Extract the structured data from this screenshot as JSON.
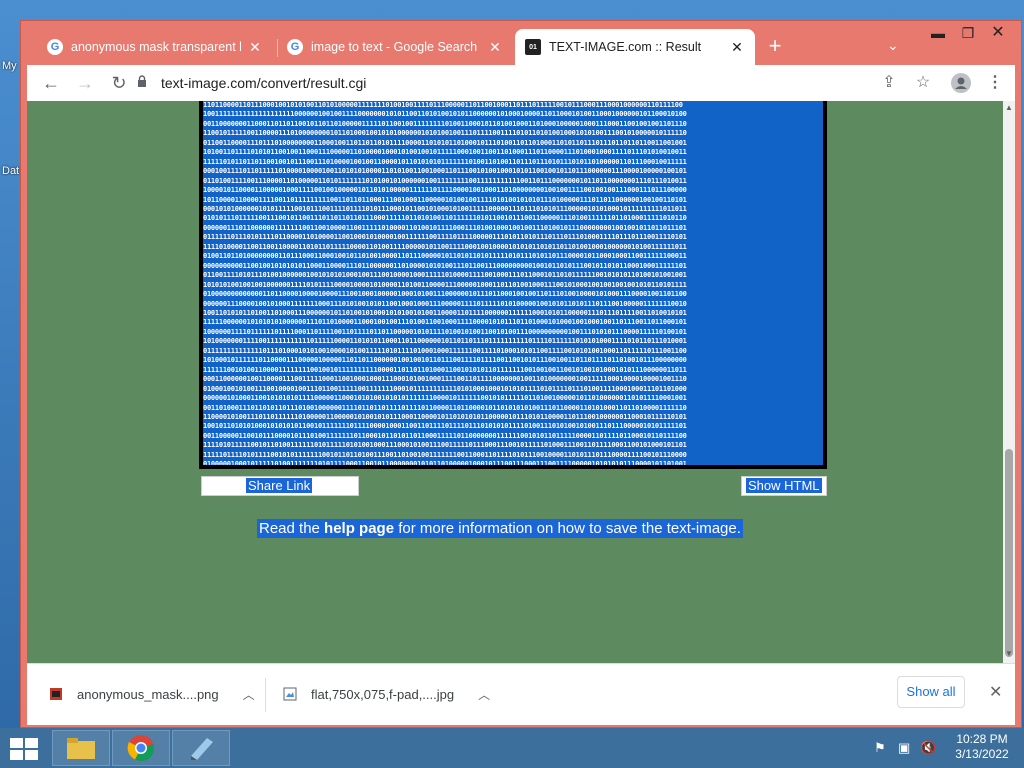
{
  "desktop": {
    "labels": [
      "My",
      "Dat"
    ]
  },
  "browser": {
    "tabs": [
      {
        "title": "anonymous mask transparent ba",
        "icon": "google-icon"
      },
      {
        "title": "image to text - Google Search",
        "icon": "google-icon"
      },
      {
        "title": "TEXT-IMAGE.com :: Result",
        "icon": "text-image-icon",
        "active": true
      }
    ],
    "url": "text-image.com/convert/result.cgi"
  },
  "page": {
    "binary_rows": [
      "1101100001101110001001010100110101000001111111010010011110111000001101100100011011101111100101110001110001000000110111100",
      "10011111111111111111111000000100100111100000001010110011010100101011000000101000100001101100010100110001000000101100010100",
      "00110000000110001101101100101101101000001111101100100111111110100110001811010010001101000100000100011100011001001001101110",
      "11001011111001100001110100000000101101000100101010000001010100100111011110011110101101010010001010100111001010000010111110",
      "01100110000111011101000000001100010011011011010111100001101010110100010111010011011010001101011011101110110110110011001001",
      "10100110111101010110010011000111000001101000010001010010010111110001001100110100011101100001110100010001111011101010010011",
      "11111010110110110010010111001110100001001001100001011010101011111110100110100110111011101011101011010000011011100010011111",
      "00010011110110111110100001000010011010101000011010100110010001101110010100100010101100100101101110000001110000100000100101",
      "01101001111001110000110100000110101111111010100101000000100111111110011111111111001101110000000101101100000001110111010011",
      "10000101100001100000100011110010010000010110101000001111110111100001001000110100000000100100111100100100111000111011100000",
      "10110000110000111100110111111111001101101100011100100011000001010010011110101001010101110100000111011011000000100100110101",
      "00010101000000101011111001011100111101111010111000101100101000101001111100000111011101010111000001010100010111111111011011",
      "01010111011111001110010110011101101101101110001111101101010011011111101011001011100110000011101001111110110100011111010110",
      "00000011101100000011111110011001000011001111101000011010010111100011101001000100100111010010111000000001001001011011011101",
      "01111110111010111101100001101000011001000101000010011111100111101111000001110101101011101110111010001111011101110011110101",
      "11110100001100110011000011010110111110000110100111100000101100111100010010000101010110101101101001000100000010100111111011",
      "01001101101000000001101110001100010010110100100001101110000010110101101011111010111010110111000010110001000110011111100011",
      "00000000001100100101010101100011000011101100000011010000101010011101100111000000000100101101011100101101011000100011111101",
      "01100111101011101001000000100101010100010011100100001000111110100001111001000111011000101101011111100101010110100101001001",
      "10101010010010010000001111010111100001000010100001101001100001110000010001101101001000111001010001001001001001010110101111",
      "01000000000000011011000010000100001110010001000001000101001110000001011101100010010011011101001000010100011100001001101100",
      "00000011100001001010001111111000111010100101011001000100011100000111101111101010000010010101101011101110010000011111110010",
      "10011010101101001101000111000000101101001010001010100101001100001101111000000111111000101011000001110111011110011010010101",
      "11111000000101010101000000111011010000110001001001110100110010001111000010101110110100010100010010001001101110011011000101",
      "10000001111011111101111000110111100110111101101100000101011110100101001100101001110000000000100111010101110000111110100101",
      "10100000001111001111111111101111100001101010110001101100000010110110111011111111110111101111110101010001111010110111010001",
      "01111111111111101110100010101001000010100111110101111010001000111111001111010001010110011110010101001000110111110111001100",
      "10100010111111011000011100000100000110110110000001001001011011100111101111001100101011100100110110111101101001011100000000",
      "11111100101001100001111111100100101111111111000011011011010001100101010110111111100100100110010100101000101011100000011011",
      "00011000000100110000111001111100011001000100011100010100100011110011011110000000100110100000001001111100010000100001001110",
      "01000100101001110010000100111011001111100111111100010111111111110101000100010101011110101111011101001111000100011101101000",
      "00000010100011001010101011110000011000101010010101011111110000101111110010101111101101001000001011010000001101011110001001",
      "00110100011101101011011101001000000111101101101111011110110000110110000101101010101001110110000110101000110110100001111110",
      "11000010100111011011111101000001100000101001010111000110000101101010101100000101110101100001101110010000001100010111110101",
      "10010110101010001010101011001011111110111100001000110011011110111101110101010111101001110101001010011101110000010101111101",
      "00110000011001011100001011101001111111011000101101011011000111110110000000111111001010110111110000110111101100010110111100",
      "11110101111100101101001111110101111101010010001110001010011100111110111000111001011111010001110011011110001100101000101101",
      "11111011110101111001010111111100101101101001110011010010011111110011000110111101011100100001101011101110000111100101110000",
      "01000001000101111101001111111010111100011001011000000010101101000001000101110011100011100111100000101010101110000101101001",
      "01010001011001101100100110100100010101001111000011000001110011100010000101000111111010111110110000111111011010111011001101"
    ],
    "share_link": "Share Link",
    "show_html": "Show HTML",
    "help": {
      "before": "Read the ",
      "link": "help page",
      "after": " for more information on how to save the text-image."
    }
  },
  "downloads": {
    "items": [
      {
        "name": "anonymous_mask....png"
      },
      {
        "name": "flat,750x,075,f-pad,....jpg"
      }
    ],
    "show_all": "Show all"
  },
  "taskbar": {
    "time": "10:28 PM",
    "date": "3/13/2022"
  }
}
